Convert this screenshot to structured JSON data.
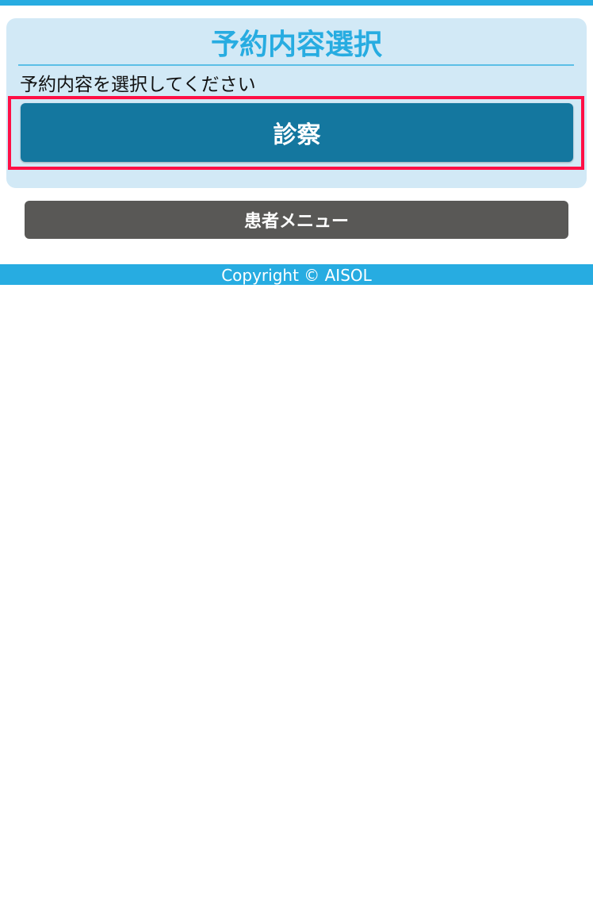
{
  "panel": {
    "title": "予約内容選択",
    "instruction": "予約内容を選択してください",
    "options": [
      {
        "label": "診察"
      }
    ]
  },
  "patient_menu_label": "患者メニュー",
  "footer": {
    "copyright": "Copyright © AISOL"
  },
  "colors": {
    "accent": "#27ace1",
    "panel_bg": "#d2e9f6",
    "primary_button": "#14779f",
    "secondary_button": "#595856",
    "highlight": "#ff0f45"
  }
}
